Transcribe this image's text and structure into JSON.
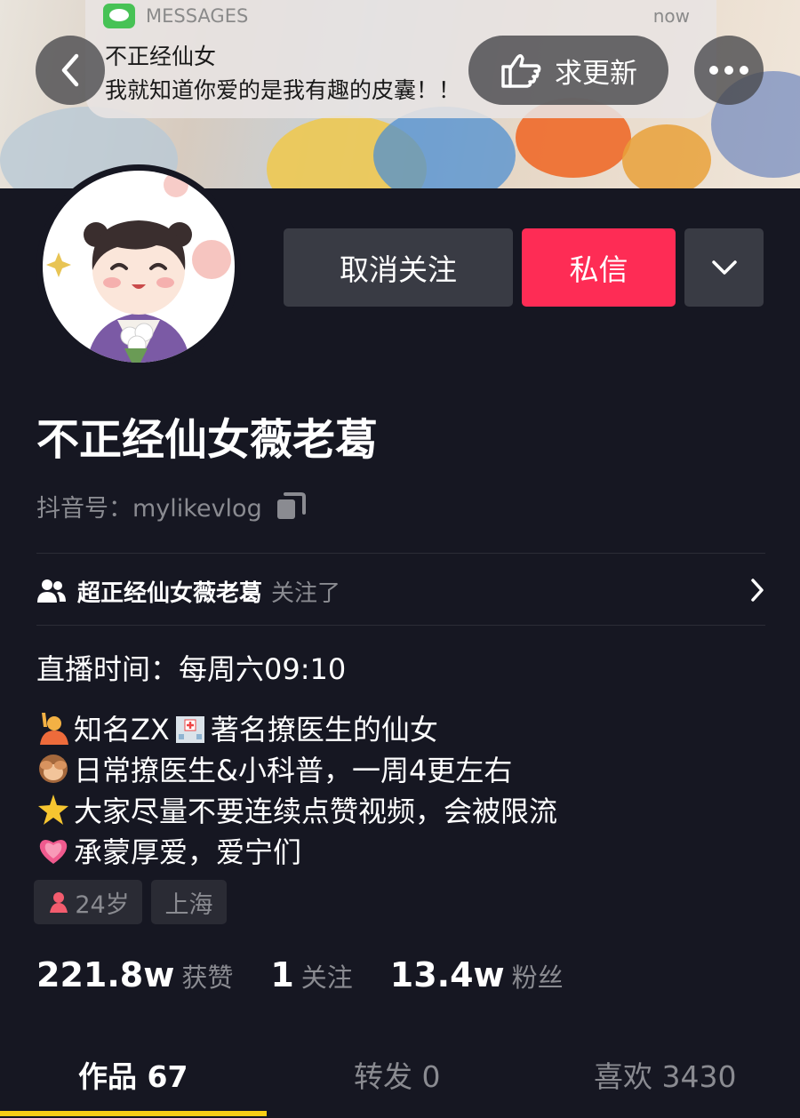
{
  "notification": {
    "app": "MESSAGES",
    "time": "now",
    "sender": "不正经仙女",
    "message": "我就知道你爱的是我有趣的皮囊！！"
  },
  "header": {
    "update_request_label": "求更新"
  },
  "actions": {
    "unfollow_label": "取消关注",
    "message_label": "私信"
  },
  "profile": {
    "name": "不正经仙女薇老葛",
    "douyin_id": "抖音号：mylikevlog"
  },
  "followed_by": {
    "name": "超正经仙女薇老葛",
    "suffix": "关注了"
  },
  "bio": {
    "live_time": "直播时间：每周六09:10",
    "lines": [
      {
        "before": "知名ZX",
        "after": "著名撩医生的仙女"
      },
      {
        "text": "日常撩医生&小科普，一周4更左右"
      },
      {
        "text": "大家尽量不要连续点赞视频，会被限流"
      },
      {
        "text": "承蒙厚爱，爱宁们"
      }
    ]
  },
  "tags": {
    "age": "24岁",
    "city": "上海"
  },
  "stats": {
    "likes_value": "221.8w",
    "likes_label": "获赞",
    "following_value": "1",
    "following_label": "关注",
    "fans_value": "13.4w",
    "fans_label": "粉丝"
  },
  "tabs": {
    "works": "作品 67",
    "reposts": "转发 0",
    "liked": "喜欢 3430"
  },
  "colors": {
    "background": "#161722",
    "accent": "#fe2c55",
    "tab_indicator": "#face15"
  }
}
